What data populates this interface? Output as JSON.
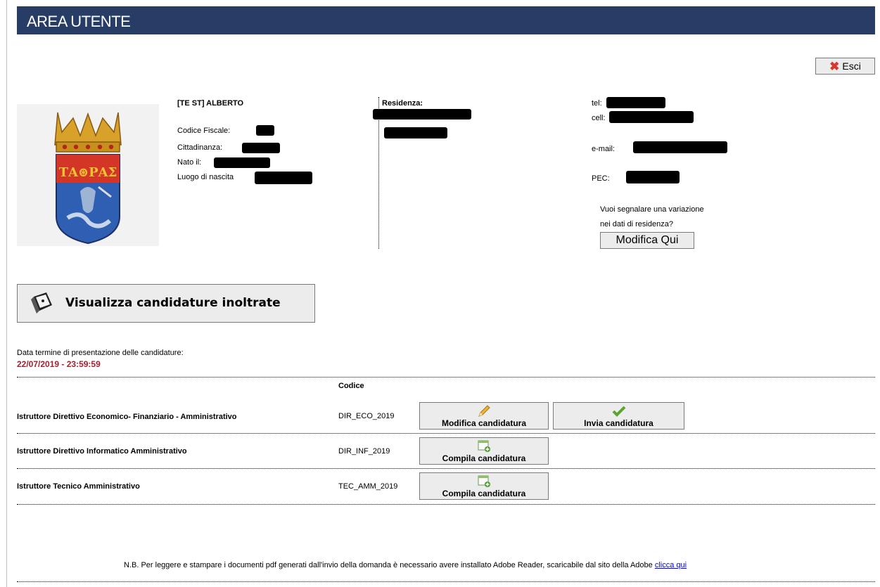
{
  "header": {
    "title": "AREA UTENTE"
  },
  "toolbar": {
    "logout_label": "Esci"
  },
  "user": {
    "name": "[TE ST] ALBERTO",
    "fiscal_code_label": "Codice Fiscale:",
    "citizenship_label": "Cittadinanza:",
    "birth_date_label": "Nato il:",
    "birth_place_label": "Luogo di nascita"
  },
  "residence": {
    "label": "Residenza:"
  },
  "contacts": {
    "tel_label": "tel:",
    "cell_label": "cell:",
    "email_label": "e-mail:",
    "pec_label": "PEC:",
    "change_question_line1": "Vuoi segnalare una variazione",
    "change_question_line2": "nei dati di residenza?",
    "modify_button": "Modifica Qui"
  },
  "view_applications_label": "Visualizza candidature inoltrate",
  "deadline": {
    "label": "Data termine di presentazione delle candidature:",
    "value": "22/07/2019 - 23:59:59"
  },
  "table": {
    "code_header": "Codice",
    "rows": [
      {
        "title": "Istruttore Direttivo Economico- Finanziario - Amministrativo",
        "code": "DIR_ECO_2019",
        "actions": [
          "Modifica candidatura",
          "Invia candidatura"
        ]
      },
      {
        "title": "Istruttore Direttivo Informatico Amministrativo",
        "code": "DIR_INF_2019",
        "actions": [
          "Compila candidatura"
        ]
      },
      {
        "title": "Istruttore Tecnico Amministrativo",
        "code": "TEC_AMM_2019",
        "actions": [
          "Compila candidatura"
        ]
      }
    ]
  },
  "footer": {
    "note": "N.B. Per leggere e stampare i documenti pdf generati dall'invio della domanda è necessario avere installato Adobe Reader, scaricabile dal sito della Adobe",
    "link": "clicca qui"
  },
  "colors": {
    "header_bg": "#283d65",
    "deadline_red": "#a32132",
    "link": "#0000ee"
  }
}
